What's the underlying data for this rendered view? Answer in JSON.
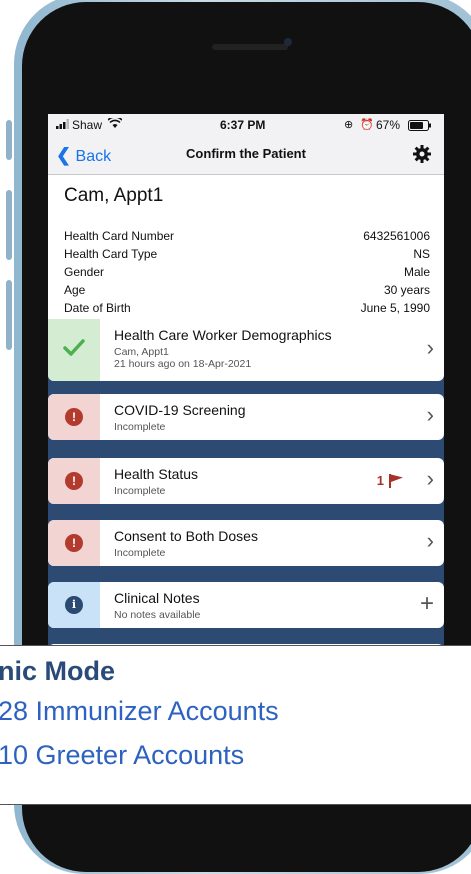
{
  "status_bar": {
    "carrier": "Shaw",
    "time": "6:37 PM",
    "battery": "67%"
  },
  "nav": {
    "back_label": "Back",
    "title": "Confirm the Patient"
  },
  "patient": {
    "name": "Cam, Appt1",
    "fields": [
      {
        "label": "Health Card Number",
        "value": "6432561006"
      },
      {
        "label": "Health Card Type",
        "value": "NS"
      },
      {
        "label": "Gender",
        "value": "Male"
      },
      {
        "label": "Age",
        "value": "30 years"
      },
      {
        "label": "Date of Birth",
        "value": "June 5, 1990"
      }
    ]
  },
  "cards": [
    {
      "title": "Health Care Worker Demographics",
      "sub1": "Cam, Appt1",
      "sub2": "21 hours ago on 18-Apr-2021",
      "status": "complete",
      "action_icon": "chevron-right-icon"
    },
    {
      "title": "COVID-19 Screening",
      "sub1": "Incomplete",
      "status": "incomplete",
      "action_icon": "chevron-right-icon"
    },
    {
      "title": "Health Status",
      "sub1": "Incomplete",
      "status": "incomplete",
      "flag_count": "1",
      "action_icon": "chevron-right-icon"
    },
    {
      "title": "Consent to Both Doses",
      "sub1": "Incomplete",
      "status": "incomplete",
      "action_icon": "chevron-right-icon"
    },
    {
      "title": "Clinical Notes",
      "sub1": "No notes available",
      "status": "info",
      "action_icon": "plus-icon"
    }
  ],
  "colors": {
    "accent_blue": "#1a73e8",
    "complete_strip": "#d4ecd2",
    "complete_check": "#4caf50",
    "incomplete_strip": "#f2d4d2",
    "incomplete_dot": "#b23b2e",
    "info_strip": "#c9e2f7",
    "screen_bg": "#2c4a72",
    "banner_title": "#2a4a7a",
    "banner_text": "#2d62c0"
  },
  "banner": {
    "title": "nic Mode",
    "lines": [
      "28 Immunizer Accounts",
      "10 Greeter Accounts"
    ]
  }
}
